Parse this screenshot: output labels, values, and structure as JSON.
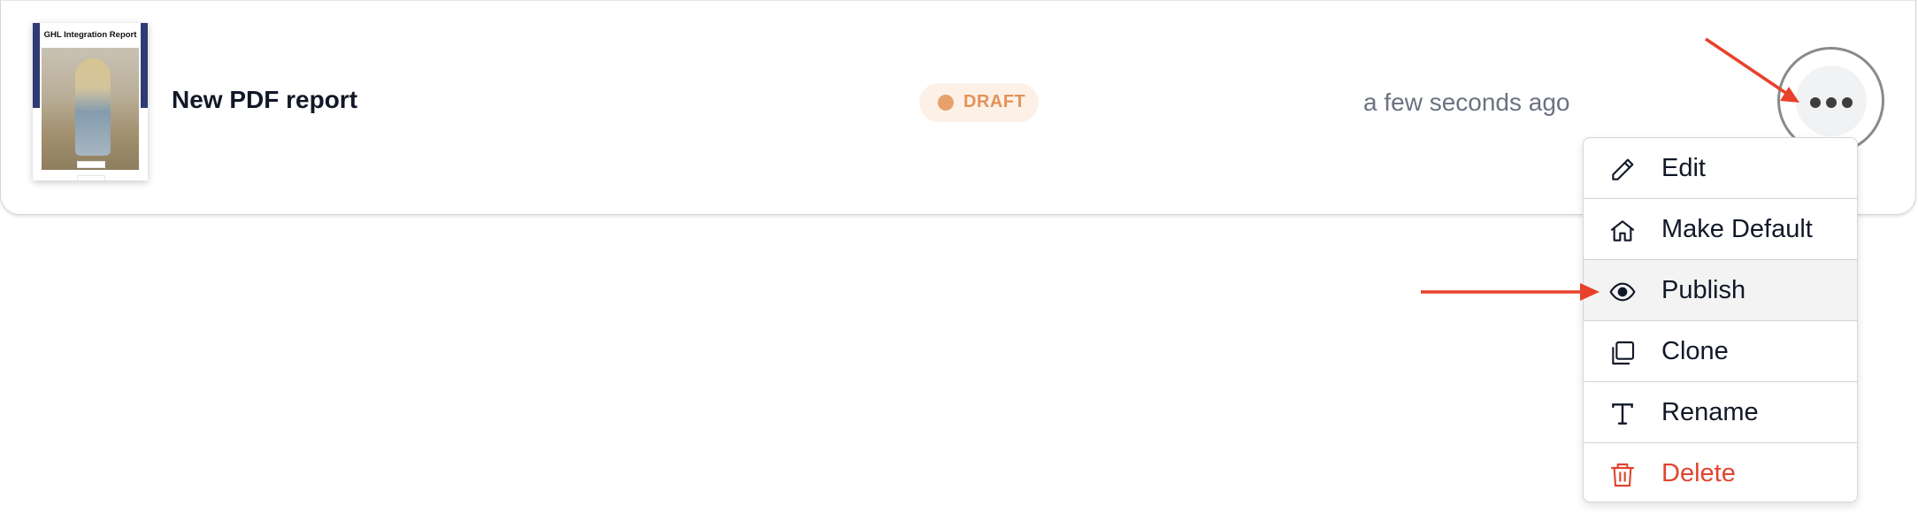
{
  "report": {
    "title": "New PDF report",
    "status": "DRAFT",
    "updated": "a few seconds ago",
    "thumbnail_title": "GHL Integration Report"
  },
  "menu": {
    "items": [
      {
        "label": "Edit",
        "icon": "pencil-icon"
      },
      {
        "label": "Make Default",
        "icon": "home-icon"
      },
      {
        "label": "Publish",
        "icon": "eye-icon"
      },
      {
        "label": "Clone",
        "icon": "copy-icon"
      },
      {
        "label": "Rename",
        "icon": "text-icon"
      },
      {
        "label": "Delete",
        "icon": "trash-icon"
      }
    ]
  },
  "colors": {
    "draft_badge_bg": "#fdf1e7",
    "draft_badge_text": "#e3925a",
    "delete_text": "#e0442f",
    "annotation_arrow": "#e8412a"
  }
}
